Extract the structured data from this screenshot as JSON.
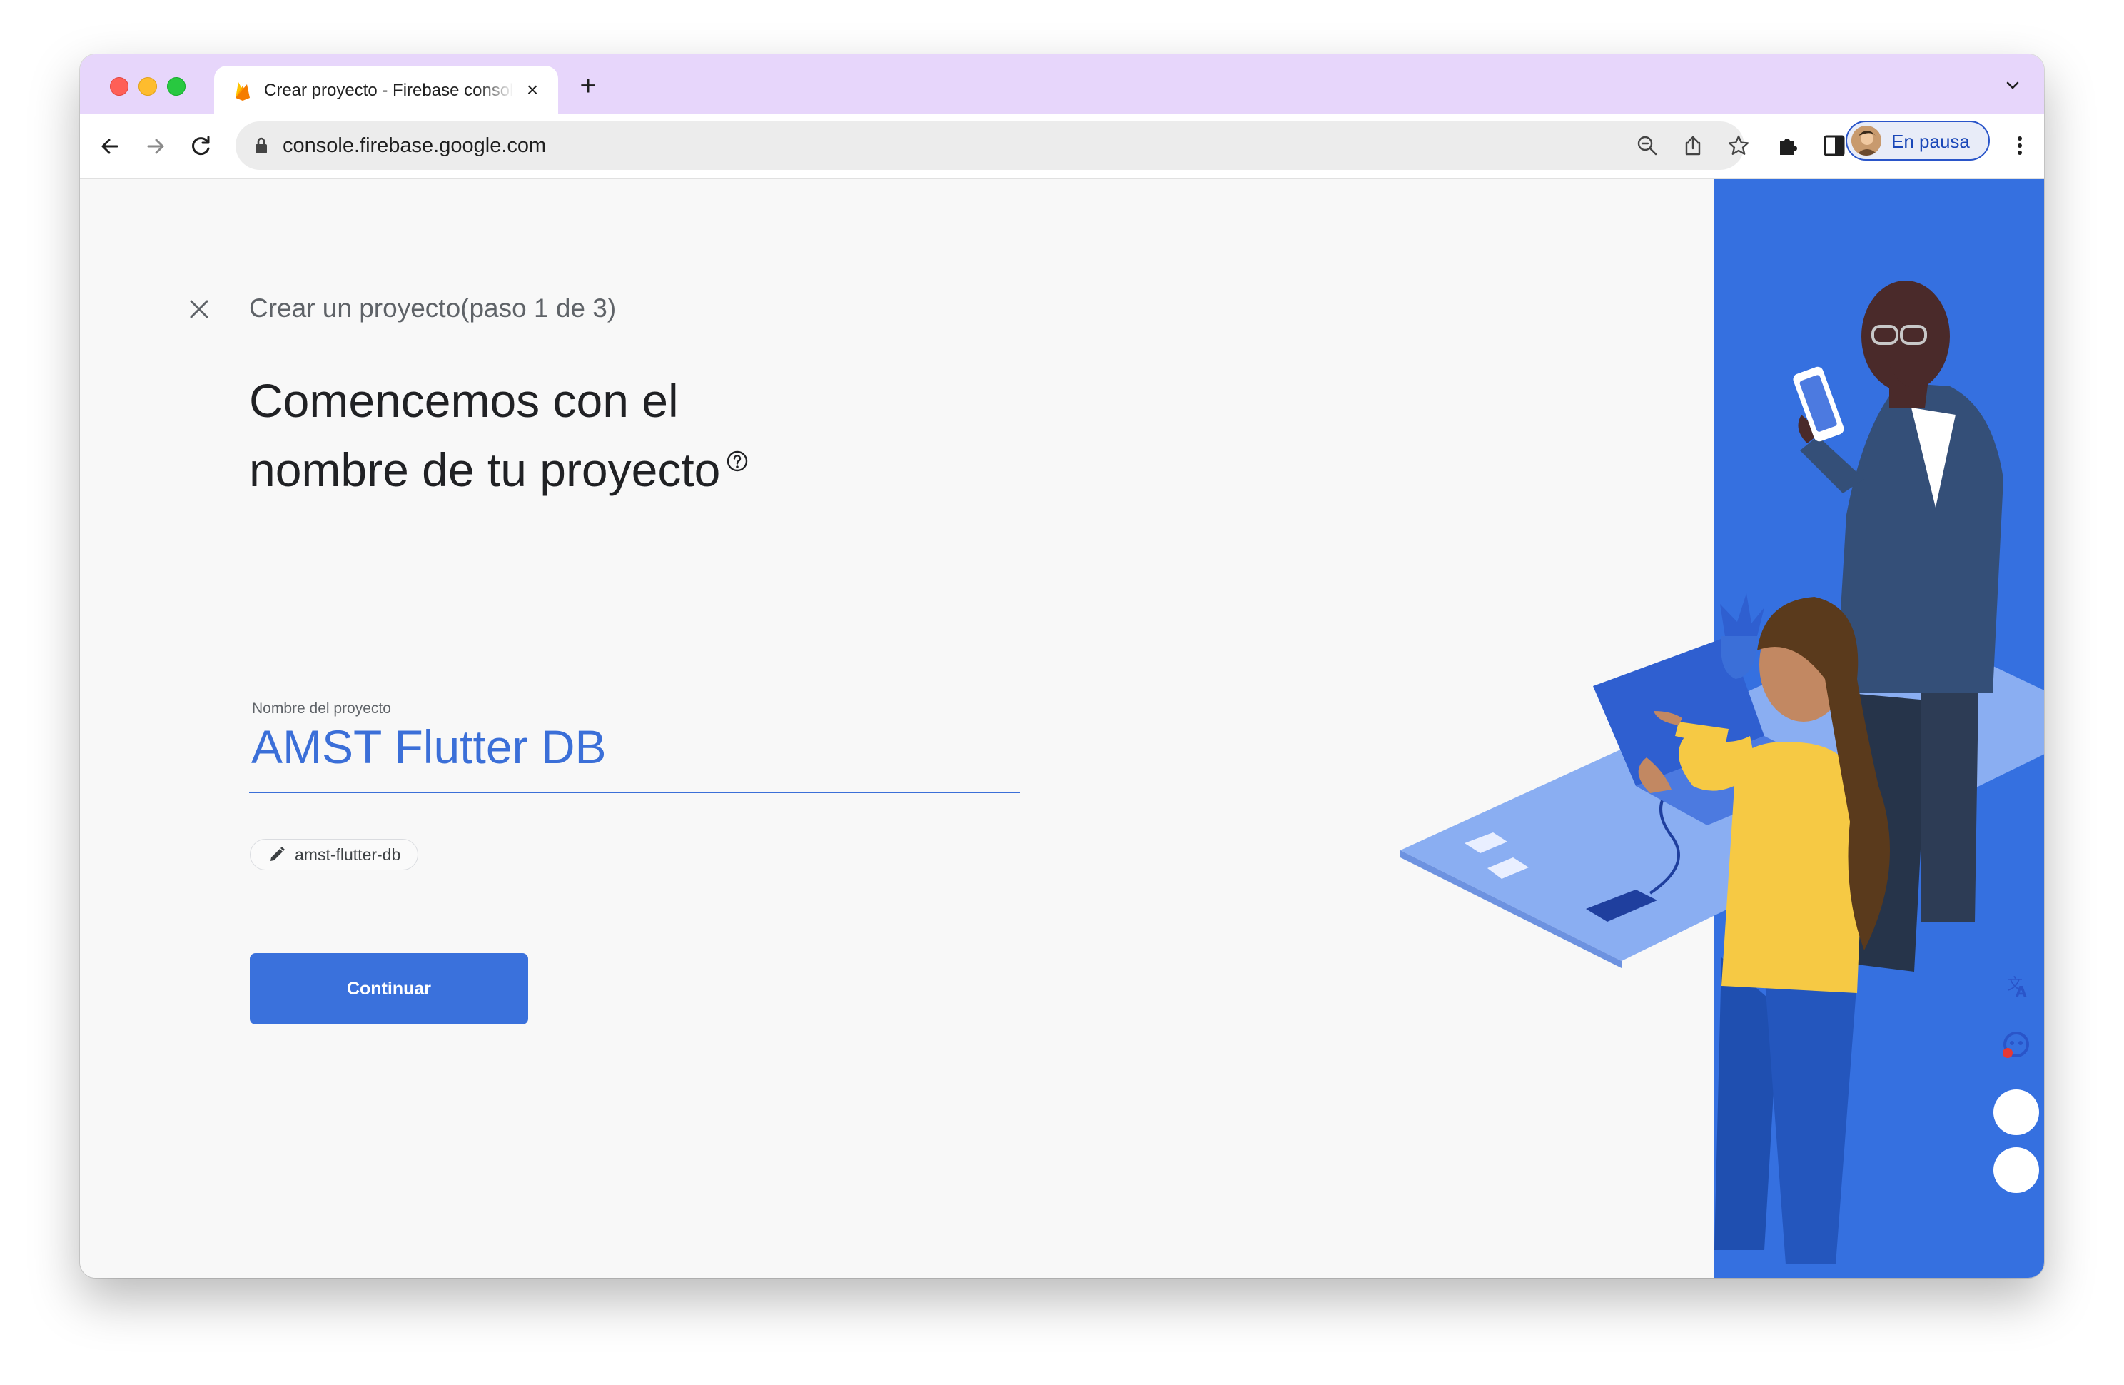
{
  "browser": {
    "tab_title": "Crear proyecto - Firebase console",
    "new_tab_symbol": "+",
    "url": "console.firebase.google.com",
    "profile_label": "En pausa",
    "accent_color": "#e7d6fb"
  },
  "wizard": {
    "step_title": "Crear un proyecto(paso 1 de 3)",
    "headline_line1": "Comencemos con el",
    "headline_line2": "nombre de tu proyecto",
    "field_label": "Nombre del proyecto",
    "field_value": "AMST Flutter DB",
    "project_id": "amst-flutter-db",
    "continue_label": "Continuar",
    "primary_color": "#3a71dc"
  },
  "icons": [
    "firebase-flame-icon",
    "close-tab-icon",
    "back-icon",
    "forward-icon",
    "reload-icon",
    "lock-icon",
    "zoom-icon",
    "share-icon",
    "bookmark-star-icon",
    "extensions-icon",
    "side-panel-icon",
    "kebab-menu-icon",
    "close-icon",
    "help-icon",
    "pencil-icon",
    "translate-icon",
    "assistant-icon"
  ]
}
